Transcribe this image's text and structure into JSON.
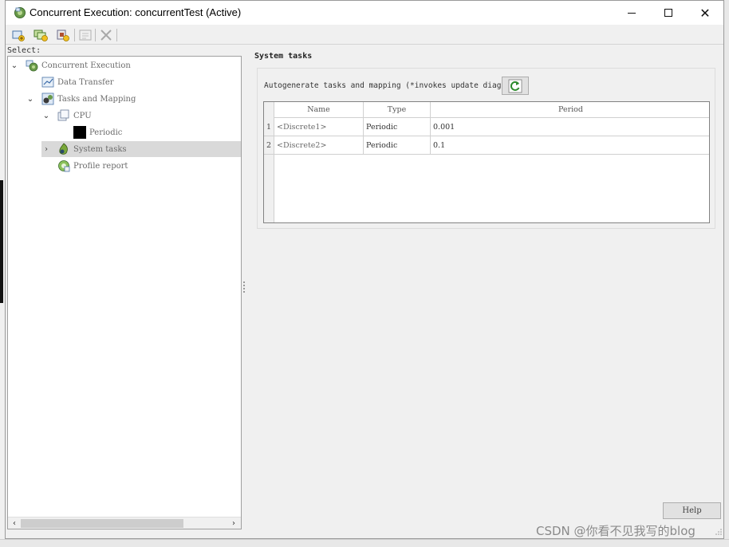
{
  "window": {
    "title": "Concurrent Execution: concurrentTest (Active)"
  },
  "toolbar": {
    "buttons": [
      {
        "name": "add-task-icon",
        "enabled": true
      },
      {
        "name": "add-group-icon",
        "enabled": true
      },
      {
        "name": "add-item-icon",
        "enabled": true
      },
      {
        "name": "edit-icon",
        "enabled": false
      },
      {
        "name": "delete-icon",
        "enabled": false
      }
    ]
  },
  "left": {
    "select_label": "Select:",
    "tree": [
      {
        "label": "Concurrent Execution",
        "icon": "concurrent-execution-icon",
        "expanded": true
      },
      {
        "label": "Data Transfer",
        "icon": "data-transfer-icon"
      },
      {
        "label": "Tasks and Mapping",
        "icon": "tasks-mapping-icon",
        "expanded": true
      },
      {
        "label": "CPU",
        "icon": "cpu-icon",
        "expanded": true
      },
      {
        "label": "Periodic",
        "icon": "periodic-icon"
      },
      {
        "label": "System tasks",
        "icon": "system-tasks-icon",
        "expanded": false,
        "selected": true
      },
      {
        "label": "Profile report",
        "icon": "profile-report-icon"
      }
    ]
  },
  "right": {
    "section_title": "System tasks",
    "autogen_label": "Autogenerate tasks and mapping (*invokes update diagram)",
    "table": {
      "headers": [
        "Name",
        "Type",
        "Period"
      ],
      "rows": [
        {
          "num": "1",
          "name": "<Discrete1>",
          "type": "Periodic",
          "period": "0.001"
        },
        {
          "num": "2",
          "name": "<Discrete2>",
          "type": "Periodic",
          "period": "0.1"
        }
      ]
    },
    "help_label": "Help"
  },
  "watermark": "CSDN @你看不见我写的blog",
  "colors": {
    "selection": "#d9d9d9",
    "refresh_green": "#2e8b2e",
    "tree_text": "#6b6b6b"
  }
}
